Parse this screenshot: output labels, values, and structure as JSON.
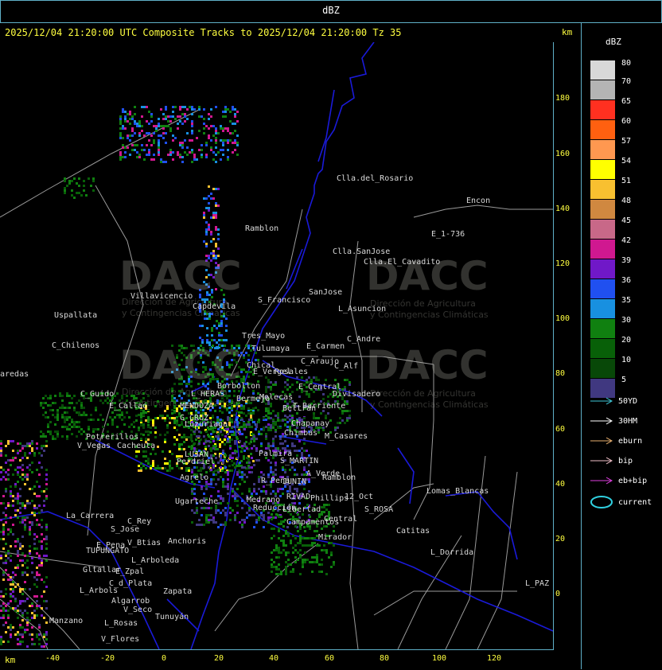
{
  "header": {
    "title": "dBZ"
  },
  "subtitle": "2025/12/04 21:20:00 UTC Composite Tracks to 2025/12/04 21:20:00 Tz 35",
  "axes": {
    "unit_label": "km",
    "y_ticks": [
      "180",
      "160",
      "140",
      "120",
      "100",
      "80",
      "60",
      "40",
      "20",
      "0"
    ],
    "x_ticks": [
      "-40",
      "-20",
      "0",
      "20",
      "40",
      "60",
      "80",
      "100",
      "120"
    ]
  },
  "legend": {
    "title": "dBZ",
    "scale": [
      {
        "label": "80",
        "color": "#d8d8d8"
      },
      {
        "label": "70",
        "color": "#b4b4b4"
      },
      {
        "label": "65",
        "color": "#ff3020"
      },
      {
        "label": "60",
        "color": "#ff6010"
      },
      {
        "label": "57",
        "color": "#ff9850"
      },
      {
        "label": "54",
        "color": "#ffff00"
      },
      {
        "label": "51",
        "color": "#f8c030"
      },
      {
        "label": "48",
        "color": "#d08840"
      },
      {
        "label": "45",
        "color": "#c86888"
      },
      {
        "label": "42",
        "color": "#d01890"
      },
      {
        "label": "39",
        "color": "#7018c8"
      },
      {
        "label": "36",
        "color": "#2050f0"
      },
      {
        "label": "35",
        "color": "#1890e0"
      },
      {
        "label": "30",
        "color": "#108010"
      },
      {
        "label": "20",
        "color": "#086008"
      },
      {
        "label": "10",
        "color": "#084808"
      },
      {
        "label": "5",
        "color": "#403880"
      }
    ],
    "tracks": [
      {
        "label": "50YD",
        "color": "#40c8d8"
      },
      {
        "label": "30HM",
        "color": "#ffffff"
      },
      {
        "label": "eburn",
        "color": "#e8b070"
      },
      {
        "label": "bip",
        "color": "#f0c0c8"
      },
      {
        "label": "eb+bip",
        "color": "#e040e0"
      },
      {
        "label": "current",
        "color": "#30d0e0"
      }
    ]
  },
  "watermark": {
    "brand": "DACC",
    "line1": "Dirección de Agricultura",
    "line2": "y Contingencias Climáticas"
  },
  "places": [
    "Clla.del_Rosario",
    "Encon",
    "Ramblon",
    "E_1-736",
    "Clla.SanJose",
    "Clla.El_Cavadito",
    "Villavicencio",
    "Uspallata",
    "S_Francisco",
    "SanJose",
    "Capdevila",
    "L_Asuncion",
    "Tres_Mayo",
    "C_Andre",
    "Tulumaya",
    "E_Carmen",
    "C_Chilenos",
    "Chical",
    "C_Araujo",
    "aredas",
    "E_Vergel",
    "Rosales",
    "C_Alf",
    "E_Central",
    "Divisadero",
    "C_Guido",
    "L_HERAS",
    "Borbollon",
    "Molecas",
    "T_Barriente",
    "E_Callao",
    "MENDOZA",
    "Bermejo",
    "G_CRUZ",
    "Beltran",
    "Chapanay",
    "Potrerillos",
    "Luzuriaga",
    "Chimbas",
    "M_Casares",
    "V_Vegas",
    "Cacheuta",
    "LUJAN",
    "Palmira",
    "S_MARTIN",
    "Perdriel",
    "A_Verde",
    "Agrelo",
    "Ramblon",
    "R_Peña",
    "JUNIN",
    "Ugarteche",
    "Medrano",
    "RIVAD",
    "Phillips",
    "12_Oct",
    "Lomas_Blancas",
    "S_ROSA",
    "Libertad",
    "La_Carrera",
    "C_Rey",
    "Reducción",
    "S_Jose",
    "Campamentos",
    "Central",
    "Catitas",
    "Anchoris",
    "Mirador",
    "E_Pena",
    "V_Btias",
    "TUPUNGATO",
    "L_Dorrida",
    "L_Arboleda",
    "Gltallar",
    "E_Zpal",
    "L_PAZ",
    "L_Arbols",
    "C_d_Plata",
    "Zapata",
    "Algarrob",
    "V_Seco",
    "Tunuyán",
    "Manzano",
    "L_Rosas",
    "V_Flores"
  ]
}
